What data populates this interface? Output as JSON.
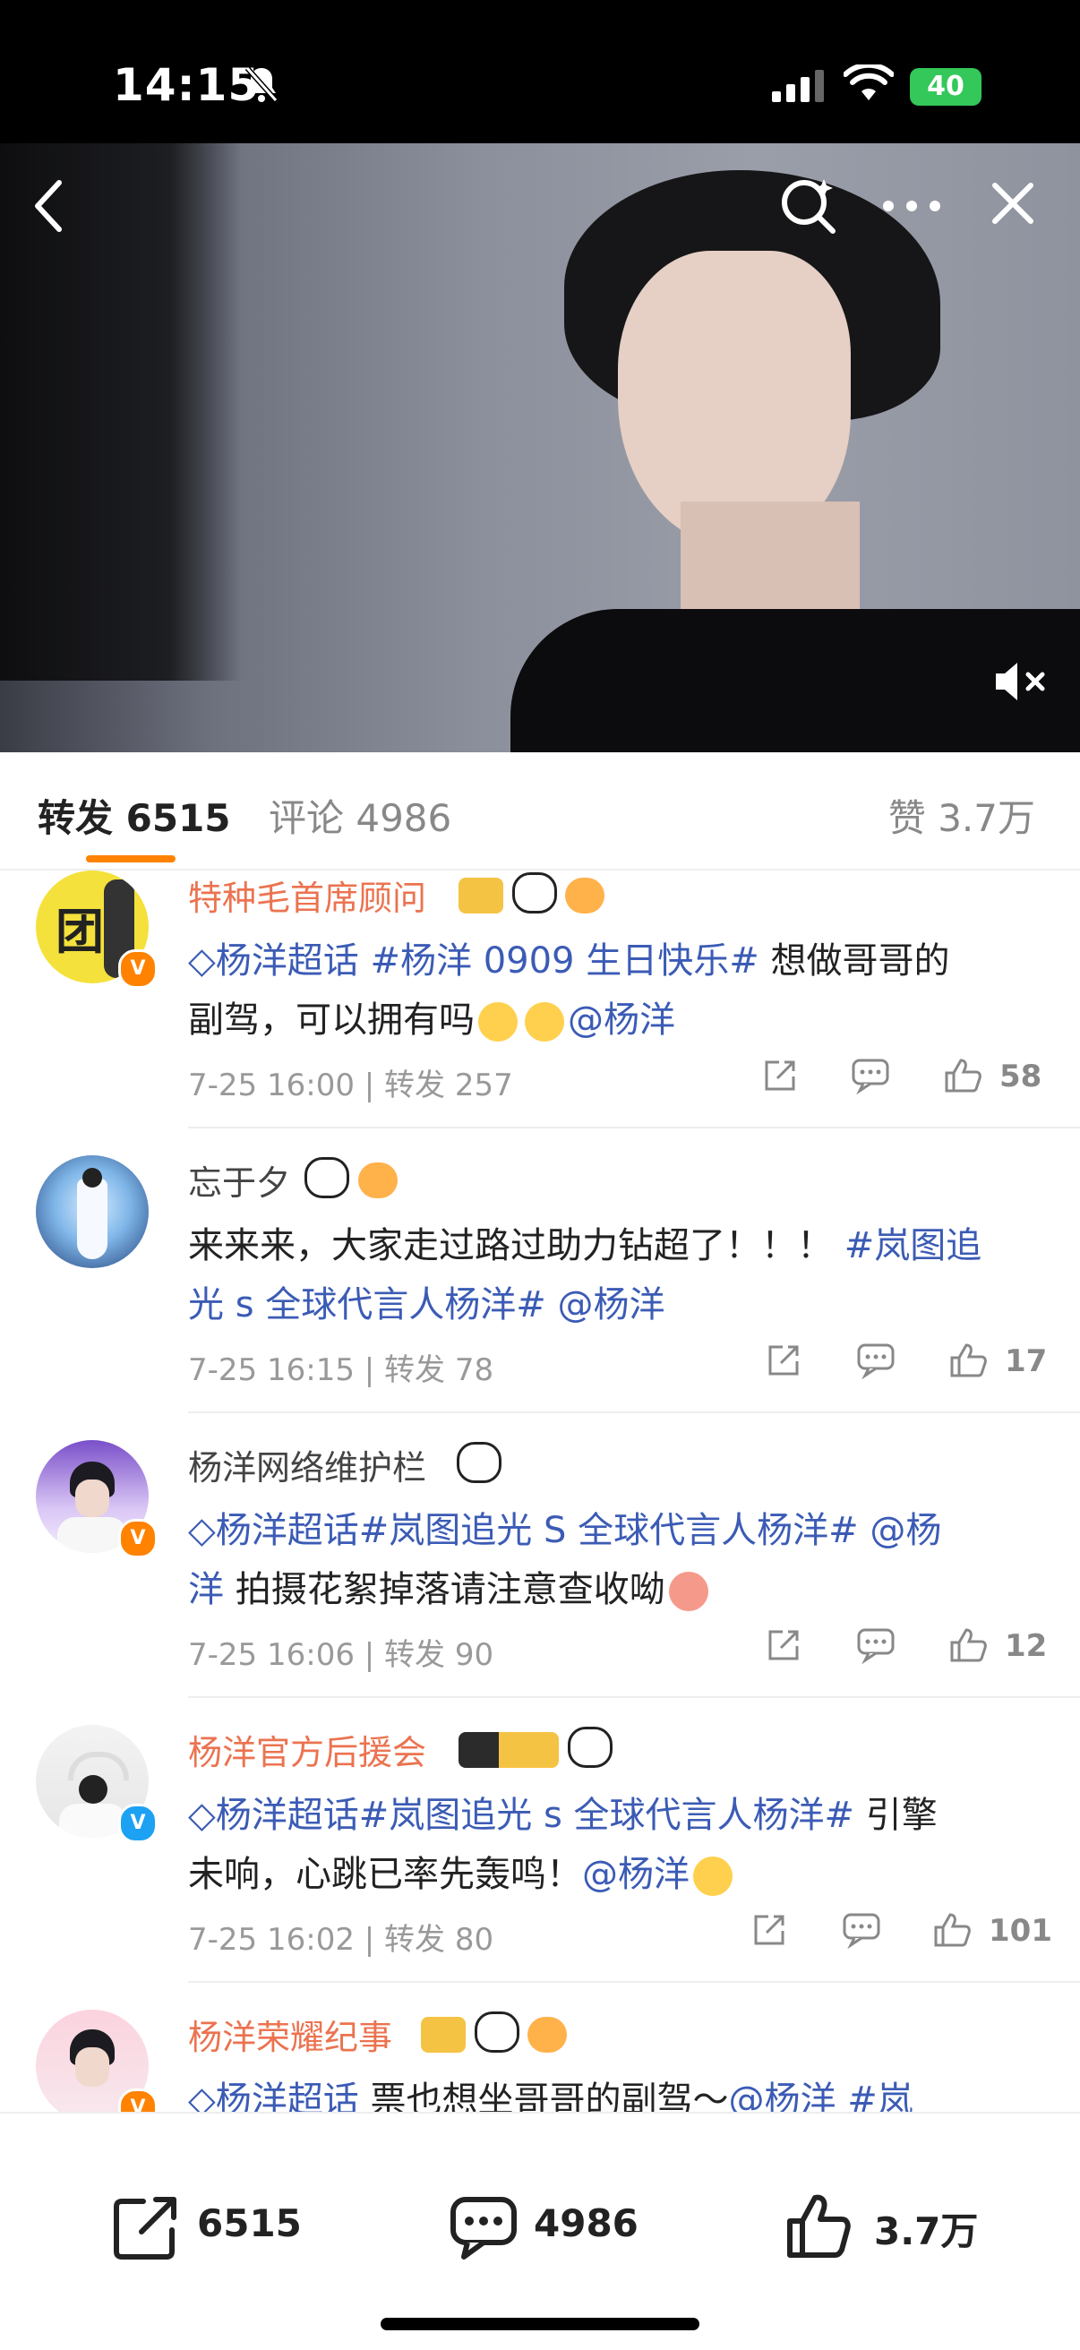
{
  "status_bar": {
    "time": "14:15",
    "battery": "40",
    "icons": [
      "bell-muted-icon",
      "signal-icon",
      "wifi-icon",
      "battery-charging-icon"
    ]
  },
  "video": {
    "controls": [
      "back-icon",
      "search-icon",
      "more-icon",
      "close-icon",
      "mute-icon"
    ]
  },
  "tabs": {
    "repost": "转发 6515",
    "comment": "评论 4986",
    "like": "赞 3.7万"
  },
  "colors": {
    "accent": "#ff8200",
    "topic": "#3b5bb5",
    "vip_name": "#eb7350",
    "meta": "#999999"
  },
  "comments": [
    {
      "name": "特种毛首席顾问",
      "vip": true,
      "avatar_text": "团",
      "badge": "V",
      "text1_topic": "◇杨洋超话 #杨洋 0909 生日快乐#",
      "text1_plain": " 想做哥哥的",
      "text2_plain": "副驾，可以拥有吗",
      "text2_topic": "@杨洋",
      "date": "7-25 16:00",
      "repost": "转发 257",
      "likes": "58"
    },
    {
      "name": "忘于夕",
      "vip": false,
      "avatar_text": "",
      "badge": "",
      "text1_plain": "来来来，大家走过路过助力钻超了！！！",
      "text1_topic": " #岚图追",
      "text2_topic": "光 s 全球代言人杨洋# @杨洋",
      "text2_plain": "",
      "date": "7-25 16:15",
      "repost": "转发 78",
      "likes": "17"
    },
    {
      "name": "杨洋网络维护栏",
      "vip": false,
      "avatar_text": "",
      "badge": "V",
      "text1_topic": "◇杨洋超话#岚图追光 S 全球代言人杨洋# @杨",
      "text1_plain": "",
      "text2_topic": "洋",
      "text2_plain": " 拍摄花絮掉落请注意查收呦",
      "date": "7-25 16:06",
      "repost": "转发 90",
      "likes": "12"
    },
    {
      "name": "杨洋官方后援会",
      "vip": true,
      "avatar_text": "",
      "badge": "V",
      "text1_topic": "◇杨洋超话#岚图追光 s 全球代言人杨洋#",
      "text1_plain": " 引擎",
      "text2_plain": "未响，心跳已率先轰鸣！",
      "text2_topic": "@杨洋",
      "date": "7-25 16:02",
      "repost": "转发 80",
      "likes": "101"
    },
    {
      "name": "杨洋荣耀纪事",
      "vip": true,
      "avatar_text": "",
      "badge": "V",
      "text1_topic": "◇杨洋超话",
      "text1_plain": " 票也想坐哥哥的副驾～",
      "text1_topic2": "@杨洋 #岚",
      "date": "",
      "repost": "",
      "likes": ""
    }
  ],
  "bottom_bar": {
    "repost": "6515",
    "comment": "4986",
    "like": "3.7万"
  }
}
